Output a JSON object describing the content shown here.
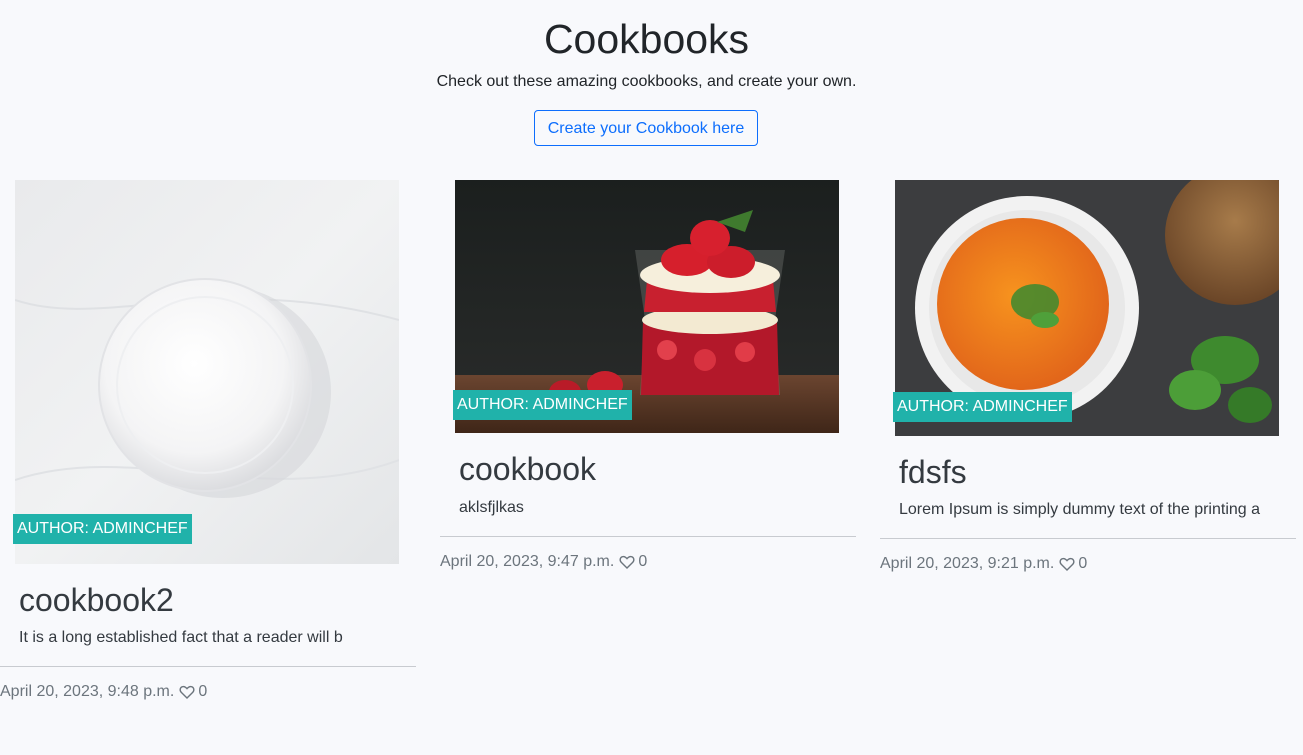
{
  "header": {
    "title": "Cookbooks",
    "subtitle": "Check out these amazing cookbooks, and create your own.",
    "create_button": "Create your Cookbook here"
  },
  "colors": {
    "badge_bg": "#20b2aa",
    "button_accent": "#0d6efd",
    "page_bg": "#f8f9fc"
  },
  "cards": [
    {
      "image_icon": "white-bowl-image",
      "author": "AUTHOR: ADMINCHEF",
      "title": "cookbook2",
      "description": "It is a long established fact that a reader will b",
      "date": "April 20, 2023, 9:48 p.m.",
      "likes": "0"
    },
    {
      "image_icon": "strawberry-parfait-image",
      "author": "AUTHOR: ADMINCHEF",
      "title": "cookbook",
      "description": "aklsfjlkas",
      "date": "April 20, 2023, 9:47 p.m.",
      "likes": "0"
    },
    {
      "image_icon": "tomato-soup-image",
      "author": "AUTHOR: ADMINCHEF",
      "title": "fdsfs",
      "description": "Lorem Ipsum is simply dummy text of the printing a",
      "date": "April 20, 2023, 9:21 p.m.",
      "likes": "0"
    }
  ]
}
